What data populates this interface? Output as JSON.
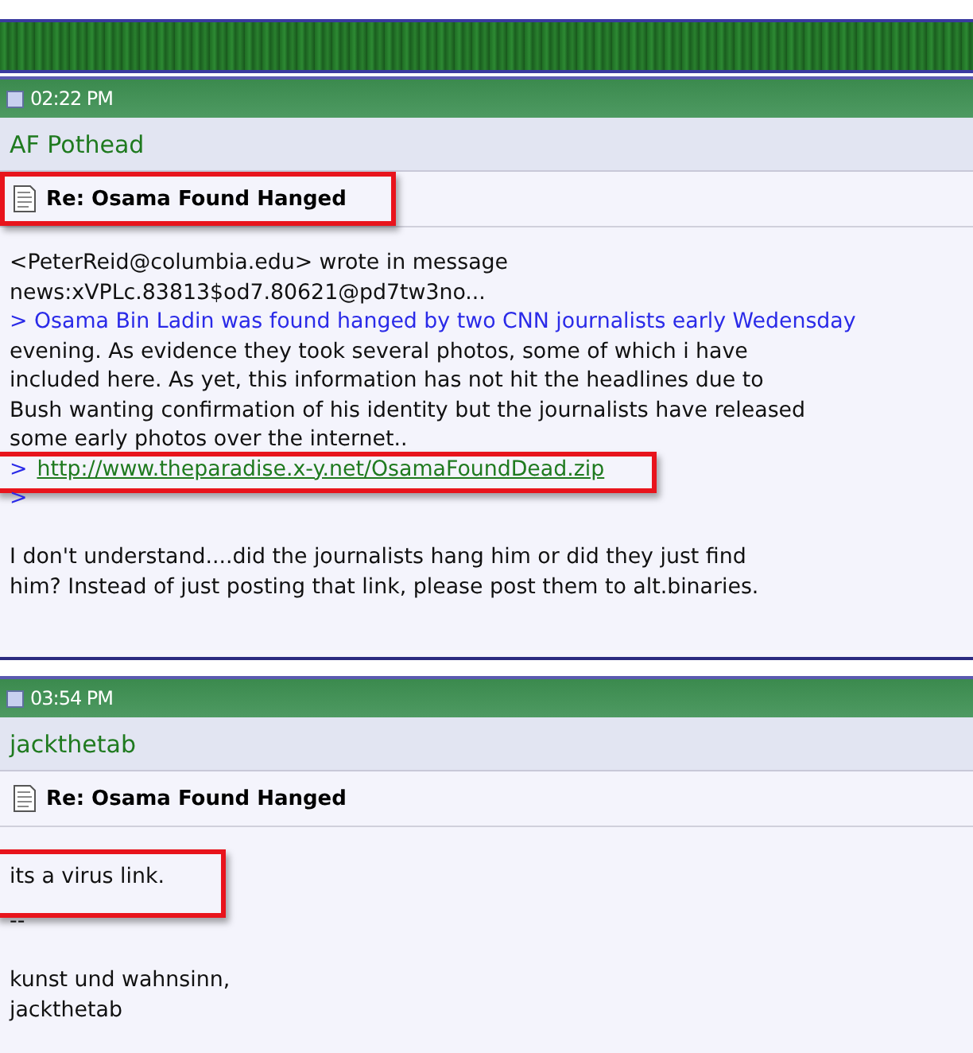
{
  "posts": [
    {
      "time": "02:22 PM",
      "author": "AF Pothead",
      "title": "Re: Osama Found Hanged",
      "title_highlighted": true,
      "lines": [
        {
          "kind": "text",
          "text": "<PeterReid@columbia.edu> wrote in message",
          "highlighted": false
        },
        {
          "kind": "text",
          "text": "news:xVPLc.83813$od7.80621@pd7tw3no...",
          "highlighted": false
        },
        {
          "kind": "quote",
          "text": "> Osama Bin Ladin was found hanged by two CNN journalists early Wedensday",
          "highlighted": false
        },
        {
          "kind": "text",
          "text": "evening. As evidence they took several photos, some of which i have",
          "highlighted": false
        },
        {
          "kind": "text",
          "text": "included here. As yet, this information has not hit the headlines due to",
          "highlighted": false
        },
        {
          "kind": "text",
          "text": "Bush wanting confirmation of his identity but the journalists have released",
          "highlighted": false
        },
        {
          "kind": "text",
          "text": "some early photos over the internet..",
          "highlighted": false
        },
        {
          "kind": "link",
          "marker": ">",
          "text": "http://www.theparadise.x-y.net/OsamaFoundDead.zip",
          "highlighted": true
        },
        {
          "kind": "quote",
          "text": ">",
          "highlighted": false
        },
        {
          "kind": "blank"
        },
        {
          "kind": "text",
          "text": "I don't understand....did the journalists hang him or did they just find",
          "highlighted": false
        },
        {
          "kind": "text",
          "text": "him? Instead of just posting that link, please post them to alt.binaries.",
          "highlighted": false
        }
      ]
    },
    {
      "time": "03:54 PM",
      "author": "jackthetab",
      "title": "Re: Osama Found Hanged",
      "title_highlighted": false,
      "lines": [
        {
          "kind": "text",
          "text": "its a virus link.",
          "highlighted": true
        },
        {
          "kind": "blank"
        },
        {
          "kind": "text",
          "text": "--",
          "highlighted": false
        },
        {
          "kind": "blank"
        },
        {
          "kind": "text",
          "text": "kunst und wahnsinn,",
          "highlighted": false
        },
        {
          "kind": "text",
          "text": "jackthetab",
          "highlighted": false
        }
      ]
    }
  ]
}
